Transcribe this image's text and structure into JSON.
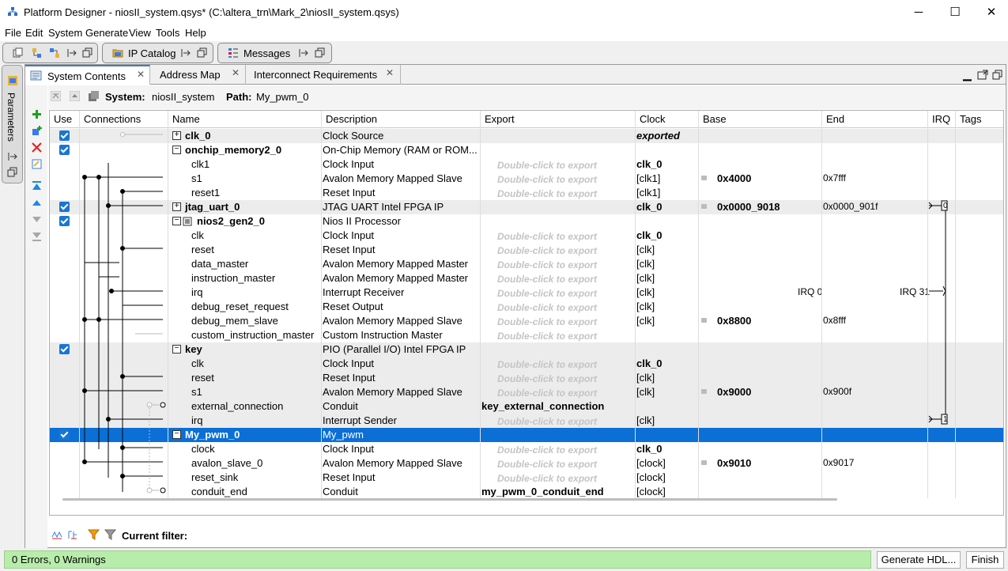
{
  "window": {
    "title": "Platform Designer - niosII_system.qsys* (C:\\altera_trn\\Mark_2\\niosII_system.qsys)",
    "minimize": "─",
    "maximize": "☐",
    "close": "✕"
  },
  "menu": [
    "File",
    "Edit",
    "System",
    "Generate",
    "View",
    "Tools",
    "Help"
  ],
  "toolbar": {
    "ip_catalog": "IP Catalog",
    "messages": "Messages"
  },
  "side_panel": {
    "label": "Parameters"
  },
  "tabs": [
    {
      "label": "System Contents",
      "active": true
    },
    {
      "label": "Address Map",
      "active": false
    },
    {
      "label": "Interconnect Requirements",
      "active": false
    }
  ],
  "system_line": {
    "system_label": "System:",
    "system_value": "niosII_system",
    "path_label": "Path:",
    "path_value": "My_pwm_0"
  },
  "columns": [
    "Use",
    "Connections",
    "Name",
    "Description",
    "Export",
    "Clock",
    "Base",
    "End",
    "IRQ",
    "Tags"
  ],
  "rows": [
    {
      "kind": "comp",
      "use": true,
      "name": "clk_0",
      "expand": "+",
      "desc": "Clock Source",
      "export": "",
      "clock": "exported",
      "clock_style": "bi",
      "base": "",
      "end": "",
      "grey": true
    },
    {
      "kind": "comp",
      "use": true,
      "name": "onchip_memory2_0",
      "expand": "−",
      "desc": "On-Chip Memory (RAM or ROM...",
      "export": "",
      "clock": "",
      "base": "",
      "end": "",
      "grey": false
    },
    {
      "kind": "iface",
      "name": "clk1",
      "desc": "Clock Input",
      "export": "Double-click to export",
      "clock": "clk_0",
      "clock_style": "b",
      "base": "",
      "end": ""
    },
    {
      "kind": "iface",
      "name": "s1",
      "desc": "Avalon Memory Mapped Slave",
      "export": "Double-click to export",
      "clock": "[clk1]",
      "base": "0x4000",
      "end": "0x7fff"
    },
    {
      "kind": "iface",
      "name": "reset1",
      "desc": "Reset Input",
      "export": "Double-click to export",
      "clock": "[clk1]",
      "base": "",
      "end": ""
    },
    {
      "kind": "comp",
      "use": true,
      "name": "jtag_uart_0",
      "expand": "+",
      "desc": "JTAG UART Intel FPGA IP",
      "export": "",
      "clock": "clk_0",
      "clock_style": "b",
      "base": "0x0000_9018",
      "end": "0x0000_901f",
      "irq": "0",
      "grey": true
    },
    {
      "kind": "comp",
      "use": true,
      "name": "nios2_gen2_0",
      "expand": "−",
      "desc": "Nios II Processor",
      "export": "",
      "clock": "",
      "base": "",
      "end": "",
      "grey": false
    },
    {
      "kind": "iface",
      "name": "clk",
      "desc": "Clock Input",
      "export": "Double-click to export",
      "clock": "clk_0",
      "clock_style": "b",
      "base": "",
      "end": ""
    },
    {
      "kind": "iface",
      "name": "reset",
      "desc": "Reset Input",
      "export": "Double-click to export",
      "clock": "[clk]",
      "base": "",
      "end": ""
    },
    {
      "kind": "iface",
      "name": "data_master",
      "desc": "Avalon Memory Mapped Master",
      "export": "Double-click to export",
      "clock": "[clk]",
      "base": "",
      "end": ""
    },
    {
      "kind": "iface",
      "name": "instruction_master",
      "desc": "Avalon Memory Mapped Master",
      "export": "Double-click to export",
      "clock": "[clk]",
      "base": "",
      "end": ""
    },
    {
      "kind": "iface",
      "name": "irq",
      "desc": "Interrupt Receiver",
      "export": "Double-click to export",
      "clock": "[clk]",
      "base": "",
      "end": "IRQ 0",
      "irq": "IRQ 31"
    },
    {
      "kind": "iface",
      "name": "debug_reset_request",
      "desc": "Reset Output",
      "export": "Double-click to export",
      "clock": "[clk]",
      "base": "",
      "end": ""
    },
    {
      "kind": "iface",
      "name": "debug_mem_slave",
      "desc": "Avalon Memory Mapped Slave",
      "export": "Double-click to export",
      "clock": "[clk]",
      "base": "0x8800",
      "end": "0x8fff"
    },
    {
      "kind": "iface",
      "name": "custom_instruction_master",
      "desc": "Custom Instruction Master",
      "export": "Double-click to export",
      "clock": "",
      "base": "",
      "end": ""
    },
    {
      "kind": "comp",
      "use": true,
      "name": "key",
      "expand": "−",
      "desc": "PIO (Parallel I/O) Intel FPGA IP",
      "export": "",
      "clock": "",
      "base": "",
      "end": "",
      "grey": true
    },
    {
      "kind": "iface",
      "name": "clk",
      "desc": "Clock Input",
      "export": "Double-click to export",
      "clock": "clk_0",
      "clock_style": "b",
      "base": "",
      "end": "",
      "grey": true
    },
    {
      "kind": "iface",
      "name": "reset",
      "desc": "Reset Input",
      "export": "Double-click to export",
      "clock": "[clk]",
      "base": "",
      "end": "",
      "grey": true
    },
    {
      "kind": "iface",
      "name": "s1",
      "desc": "Avalon Memory Mapped Slave",
      "export": "Double-click to export",
      "clock": "[clk]",
      "base": "0x9000",
      "end": "0x900f",
      "grey": true
    },
    {
      "kind": "iface",
      "name": "external_connection",
      "desc": "Conduit",
      "export": "key_external_connection",
      "export_style": "b",
      "clock": "",
      "base": "",
      "end": "",
      "grey": true
    },
    {
      "kind": "iface",
      "name": "irq",
      "desc": "Interrupt Sender",
      "export": "Double-click to export",
      "clock": "[clk]",
      "base": "",
      "end": "",
      "irq": "1",
      "grey": true
    },
    {
      "kind": "comp",
      "use": true,
      "name": "My_pwm_0",
      "expand": "−",
      "desc": "My_pwm",
      "export": "",
      "clock": "",
      "base": "",
      "end": "",
      "selected": true
    },
    {
      "kind": "iface",
      "name": "clock",
      "desc": "Clock Input",
      "export": "Double-click to export",
      "clock": "clk_0",
      "clock_style": "b",
      "base": "",
      "end": ""
    },
    {
      "kind": "iface",
      "name": "avalon_slave_0",
      "desc": "Avalon Memory Mapped Slave",
      "export": "Double-click to export",
      "clock": "[clock]",
      "base": "0x9010",
      "end": "0x9017"
    },
    {
      "kind": "iface",
      "name": "reset_sink",
      "desc": "Reset Input",
      "export": "Double-click to export",
      "clock": "[clock]",
      "base": "",
      "end": ""
    },
    {
      "kind": "iface",
      "name": "conduit_end",
      "desc": "Conduit",
      "export": "my_pwm_0_conduit_end",
      "export_style": "b",
      "clock": "[clock]",
      "base": "",
      "end": ""
    }
  ],
  "filter": {
    "label": "Current filter:"
  },
  "status": {
    "text": "0 Errors, 0 Warnings"
  },
  "buttons": {
    "generate": "Generate HDL...",
    "finish": "Finish"
  },
  "colors": {
    "selection": "#0b6fd6",
    "checkbox": "#1976d2",
    "status_ok": "#b8ecaa",
    "add_icon": "#1aa31a",
    "remove_icon": "#e02020"
  }
}
